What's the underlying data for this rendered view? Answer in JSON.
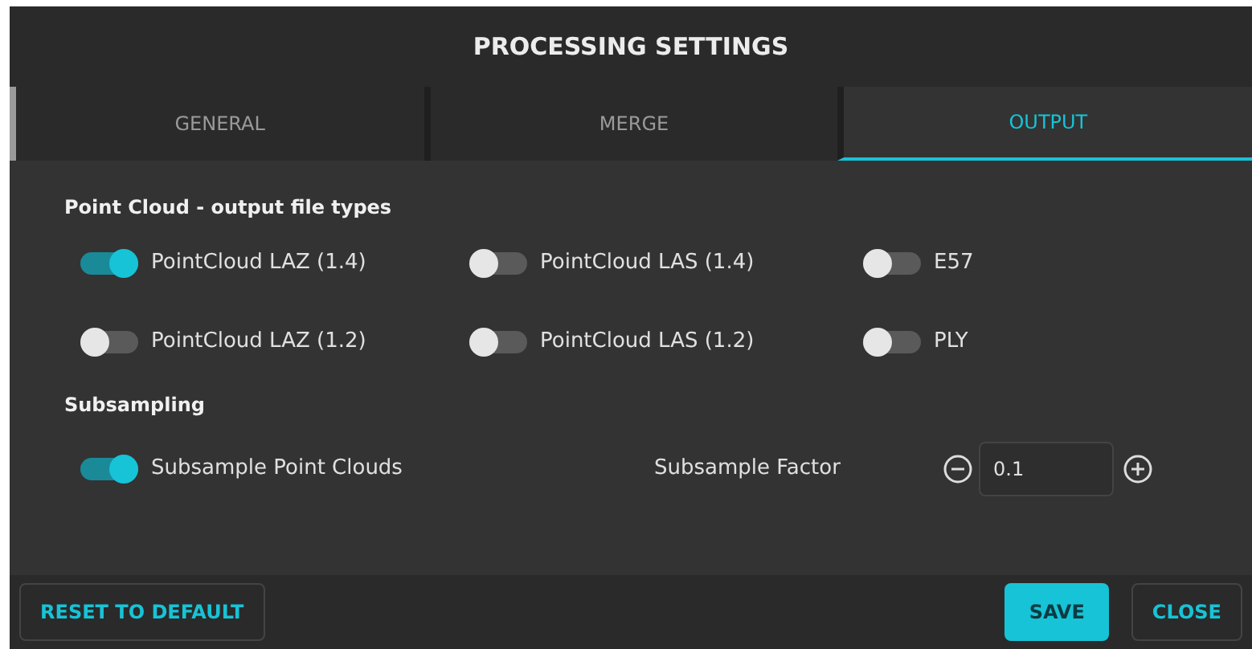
{
  "window": {
    "title": "PROCESSING SETTINGS"
  },
  "tabs": [
    {
      "label": "GENERAL",
      "selected": false
    },
    {
      "label": "MERGE",
      "selected": false
    },
    {
      "label": "OUTPUT",
      "selected": true
    }
  ],
  "output_section": {
    "heading": "Point Cloud - output file types",
    "toggles": [
      {
        "label": "PointCloud LAZ (1.4)",
        "on": true
      },
      {
        "label": "PointCloud LAS (1.4)",
        "on": false
      },
      {
        "label": "E57",
        "on": false
      },
      {
        "label": "PointCloud LAZ (1.2)",
        "on": false
      },
      {
        "label": "PointCloud LAS (1.2)",
        "on": false
      },
      {
        "label": "PLY",
        "on": false
      }
    ]
  },
  "subsampling": {
    "heading": "Subsampling",
    "toggle": {
      "label": "Subsample Point Clouds",
      "on": true
    },
    "factor_label": "Subsample Factor",
    "factor_value": "0.1"
  },
  "footer": {
    "reset": "RESET TO DEFAULT",
    "save": "SAVE",
    "close": "CLOSE"
  }
}
